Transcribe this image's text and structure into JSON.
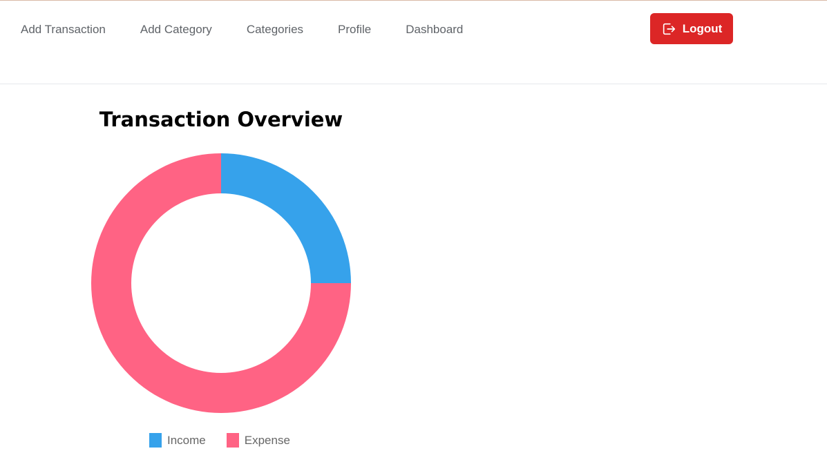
{
  "nav": {
    "links": [
      "Add Transaction",
      "Add Category",
      "Categories",
      "Profile",
      "Dashboard"
    ],
    "logout_label": "Logout",
    "logout_icon": "logout-icon",
    "logout_color": "#dc2626"
  },
  "chart_data": {
    "type": "pie",
    "variant": "doughnut",
    "title": "Transaction Overview",
    "categories": [
      "Income",
      "Expense"
    ],
    "values": [
      25,
      75
    ],
    "colors": [
      "#36a2eb",
      "#ff6384"
    ],
    "legend": "bottom"
  }
}
